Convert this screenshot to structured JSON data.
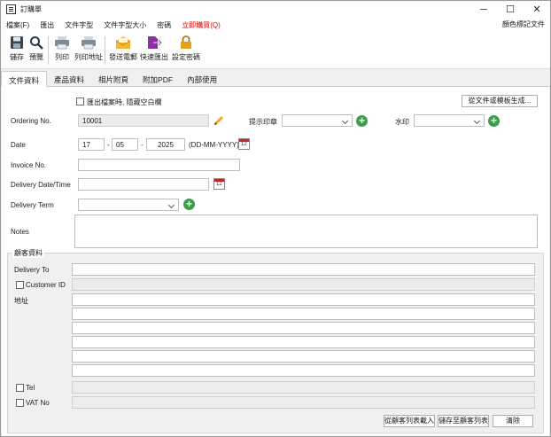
{
  "window": {
    "title": "訂購單",
    "minimize": "─",
    "maximize": "☐",
    "close": "✕"
  },
  "menu": {
    "items": [
      {
        "label": "檔案(F)",
        "red": false
      },
      {
        "label": "匯出",
        "red": false
      },
      {
        "label": "文件字型",
        "red": false
      },
      {
        "label": "文件字型大小",
        "red": false
      },
      {
        "label": "密碼",
        "red": false
      },
      {
        "label": "立即購買(Q)",
        "red": true
      }
    ],
    "right": "顏色標記文件"
  },
  "toolbar": {
    "save": "儲存",
    "preview": "預覽",
    "print": "列印",
    "print_address": "列印地址",
    "send_email": "發送電郵",
    "quick_export": "快速匯出",
    "set_password": "設定密碼"
  },
  "tabs": [
    {
      "label": "文件資料"
    },
    {
      "label": "產品資料"
    },
    {
      "label": "相片附頁"
    },
    {
      "label": "附加PDF"
    },
    {
      "label": "內部使用"
    }
  ],
  "form": {
    "hide_blank_label": "匯出檔案時, 隱藏空白欄",
    "generate_button": "從文件或模板生成...",
    "ordering_no_label": "Ordering No.",
    "ordering_no_value": "10001",
    "stamp_label": "提示印章",
    "watermark_label": "水印",
    "date_label": "Date",
    "date_day": "17",
    "date_month": "05",
    "date_year": "2025",
    "date_dash": "-",
    "date_format": "(DD-MM-YYYY)",
    "invoice_label": "Invoice No.",
    "delivery_date_label": "Delivery Date/Time",
    "delivery_term_label": "Delivery Term",
    "notes_label": "Notes"
  },
  "customer": {
    "group_title": "顧客資料",
    "delivery_to": "Delivery To",
    "customer_id": "Customer ID",
    "address": "地址",
    "tel": "Tel",
    "vat": "VAT No",
    "load_button": "從顧客列表載入",
    "save_button": "儲存至顧客列表",
    "clear_button": "清除"
  },
  "icons": {
    "save": "floppy-disk-icon",
    "preview": "magnifier-icon",
    "print": "printer-icon",
    "email": "envelope-icon",
    "export": "export-icon",
    "lock": "lock-icon"
  },
  "colors": {
    "accent_red": "#d00000",
    "plus_green": "#3aa047",
    "lock_gold": "#e2a21e",
    "export_purple": "#8b2fa8"
  }
}
